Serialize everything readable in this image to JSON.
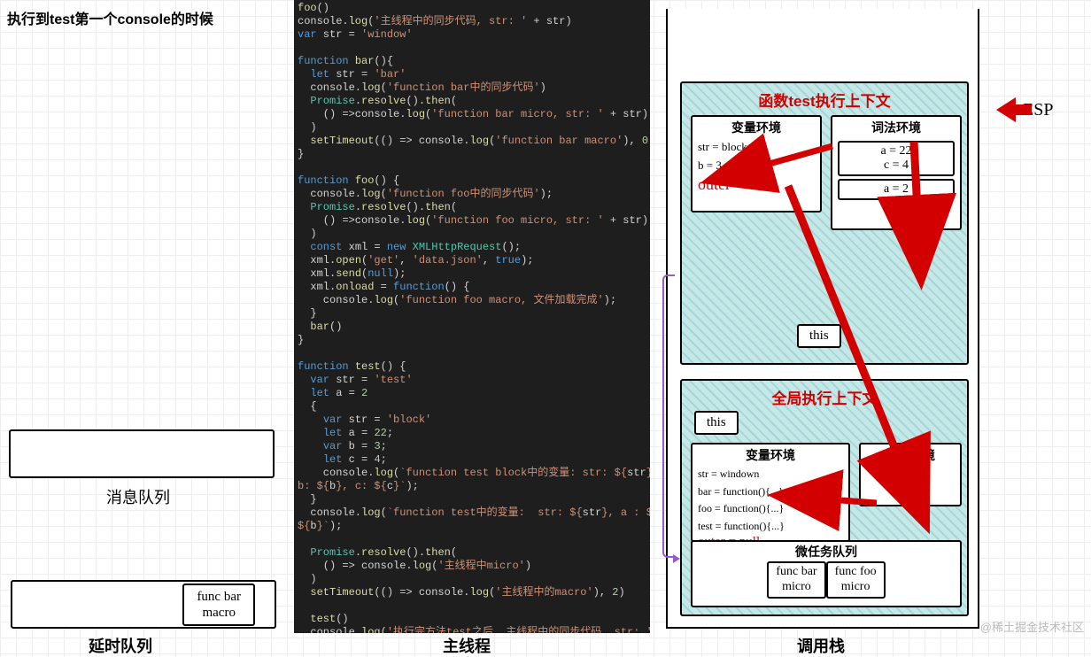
{
  "title": "执行到test第一个console的时候",
  "labels": {
    "message_queue": "消息队列",
    "delay_queue": "延时队列",
    "main_thread": "主线程",
    "call_stack": "调用栈",
    "esp": "ESP"
  },
  "delay_queue_items": [
    {
      "line1": "func bar",
      "line2": "macro"
    }
  ],
  "code": {
    "lines": [
      [
        [
          "fn",
          "foo"
        ],
        [
          "",
          "()"
        ]
      ],
      [
        [
          "",
          "console."
        ],
        [
          "fn",
          "log"
        ],
        [
          "",
          "("
        ],
        [
          "str",
          "'主线程中的同步代码, str: '"
        ],
        [
          "",
          "",
          " + str)"
        ]
      ],
      [
        [
          "kw",
          "var"
        ],
        [
          "",
          " str = "
        ],
        [
          "str",
          "'window'"
        ]
      ],
      [
        [
          "",
          ""
        ]
      ],
      [
        [
          "kw",
          "function"
        ],
        [
          "",
          " "
        ],
        [
          "fn",
          "bar"
        ],
        [
          "",
          "(){"
        ]
      ],
      [
        [
          "",
          "  "
        ],
        [
          "kw",
          "let"
        ],
        [
          "",
          " str = "
        ],
        [
          "str",
          "'bar'"
        ]
      ],
      [
        [
          "",
          "  console."
        ],
        [
          "fn",
          "log"
        ],
        [
          "",
          "("
        ],
        [
          "str",
          "'function bar中的同步代码'"
        ],
        [
          "",
          ")"
        ]
      ],
      [
        [
          "",
          "  "
        ],
        [
          "cls",
          "Promise"
        ],
        [
          "",
          "."
        ],
        [
          "fn",
          "resolve"
        ],
        [
          "",
          "()."
        ],
        [
          "fn",
          "then"
        ],
        [
          "",
          "("
        ]
      ],
      [
        [
          "",
          "    () =>console."
        ],
        [
          "fn",
          "log"
        ],
        [
          "",
          "("
        ],
        [
          "str",
          "'function bar micro, str: '"
        ],
        [
          "",
          "",
          " + str)"
        ]
      ],
      [
        [
          "",
          "  )"
        ]
      ],
      [
        [
          "",
          "  "
        ],
        [
          "fn",
          "setTimeout"
        ],
        [
          "",
          "(() => console."
        ],
        [
          "fn",
          "log"
        ],
        [
          "",
          "("
        ],
        [
          "str",
          "'function bar macro'"
        ],
        [
          "",
          "), "
        ],
        [
          "num",
          "0"
        ],
        [
          "",
          ")"
        ]
      ],
      [
        [
          "",
          "}"
        ]
      ],
      [
        [
          "",
          ""
        ]
      ],
      [
        [
          "kw",
          "function"
        ],
        [
          "",
          " "
        ],
        [
          "fn",
          "foo"
        ],
        [
          "",
          "() {"
        ]
      ],
      [
        [
          "",
          "  console."
        ],
        [
          "fn",
          "log"
        ],
        [
          "",
          "("
        ],
        [
          "str",
          "'function foo中的同步代码'"
        ],
        [
          "",
          ");"
        ]
      ],
      [
        [
          "",
          "  "
        ],
        [
          "cls",
          "Promise"
        ],
        [
          "",
          "."
        ],
        [
          "fn",
          "resolve"
        ],
        [
          "",
          "()."
        ],
        [
          "fn",
          "then"
        ],
        [
          "",
          "("
        ]
      ],
      [
        [
          "",
          "    () =>console."
        ],
        [
          "fn",
          "log"
        ],
        [
          "",
          "("
        ],
        [
          "str",
          "'function foo micro, str: '"
        ],
        [
          "",
          "",
          " + str)"
        ]
      ],
      [
        [
          "",
          "  )"
        ]
      ],
      [
        [
          "",
          "  "
        ],
        [
          "kw",
          "const"
        ],
        [
          "",
          " xml = "
        ],
        [
          "kw",
          "new"
        ],
        [
          "",
          " "
        ],
        [
          "cls",
          "XMLHttpRequest"
        ],
        [
          "",
          "();"
        ]
      ],
      [
        [
          "",
          "  xml."
        ],
        [
          "fn",
          "open"
        ],
        [
          "",
          "("
        ],
        [
          "str",
          "'get'"
        ],
        [
          "",
          ", "
        ],
        [
          "str",
          "'data.json'"
        ],
        [
          "",
          ", "
        ],
        [
          "kw",
          "true"
        ],
        [
          "",
          ");"
        ]
      ],
      [
        [
          "",
          "  xml."
        ],
        [
          "fn",
          "send"
        ],
        [
          "",
          "("
        ],
        [
          "kw",
          "null"
        ],
        [
          "",
          ");"
        ]
      ],
      [
        [
          "",
          "  xml."
        ],
        [
          "fn",
          "onload"
        ],
        [
          "",
          " = "
        ],
        [
          "kw",
          "function"
        ],
        [
          "",
          "() {"
        ]
      ],
      [
        [
          "",
          "    console."
        ],
        [
          "fn",
          "log"
        ],
        [
          "",
          "("
        ],
        [
          "str",
          "'function foo macro, 文件加载完成'"
        ],
        [
          "",
          ");"
        ]
      ],
      [
        [
          "",
          "  }"
        ]
      ],
      [
        [
          "",
          "  "
        ],
        [
          "fn",
          "bar"
        ],
        [
          "",
          "()"
        ]
      ],
      [
        [
          "",
          "}"
        ]
      ],
      [
        [
          "",
          ""
        ]
      ],
      [
        [
          "kw",
          "function"
        ],
        [
          "",
          " "
        ],
        [
          "fn",
          "test"
        ],
        [
          "",
          "() {"
        ]
      ],
      [
        [
          "",
          "  "
        ],
        [
          "kw",
          "var"
        ],
        [
          "",
          " str = "
        ],
        [
          "str",
          "'test'"
        ]
      ],
      [
        [
          "",
          "  "
        ],
        [
          "kw",
          "let"
        ],
        [
          "",
          " a = "
        ],
        [
          "num",
          "2"
        ]
      ],
      [
        [
          "",
          "  {"
        ]
      ],
      [
        [
          "",
          "    "
        ],
        [
          "kw",
          "var"
        ],
        [
          "",
          " str = "
        ],
        [
          "str",
          "'block'"
        ]
      ],
      [
        [
          "",
          "    "
        ],
        [
          "kw",
          "let"
        ],
        [
          "",
          " a = "
        ],
        [
          "num",
          "22"
        ],
        [
          "",
          ";"
        ]
      ],
      [
        [
          "",
          "    "
        ],
        [
          "kw",
          "var"
        ],
        [
          "",
          " b = "
        ],
        [
          "num",
          "3"
        ],
        [
          "",
          ";"
        ]
      ],
      [
        [
          "",
          "    "
        ],
        [
          "kw",
          "let"
        ],
        [
          "",
          " c = "
        ],
        [
          "num",
          "4"
        ],
        [
          "",
          ";"
        ]
      ],
      [
        [
          "",
          "    console."
        ],
        [
          "fn",
          "log"
        ],
        [
          "",
          "("
        ],
        [
          "str",
          "`function test block中的变量: str: ${"
        ],
        [
          "",
          "str"
        ],
        [
          "str",
          "}, a : ${"
        ],
        [
          "",
          "a"
        ],
        [
          "str",
          "},"
        ]
      ],
      [
        [
          "str",
          "b: ${"
        ],
        [
          "",
          "b"
        ],
        [
          "str",
          "}, c: ${"
        ],
        [
          "",
          "c"
        ],
        [
          "str",
          "}`"
        ],
        [
          "",
          ");"
        ]
      ],
      [
        [
          "",
          "  }"
        ]
      ],
      [
        [
          "",
          "  console."
        ],
        [
          "fn",
          "log"
        ],
        [
          "",
          "("
        ],
        [
          "str",
          "`function test中的变量:  str: ${"
        ],
        [
          "",
          "str"
        ],
        [
          "str",
          "}, a : ${"
        ],
        [
          "",
          "a"
        ],
        [
          "str",
          "}, b:"
        ]
      ],
      [
        [
          "str",
          "${"
        ],
        [
          "",
          "b"
        ],
        [
          "str",
          "}`"
        ],
        [
          "",
          ");"
        ]
      ],
      [
        [
          "",
          ""
        ]
      ],
      [
        [
          "",
          "  "
        ],
        [
          "cls",
          "Promise"
        ],
        [
          "",
          "."
        ],
        [
          "fn",
          "resolve"
        ],
        [
          "",
          "()."
        ],
        [
          "fn",
          "then"
        ],
        [
          "",
          "("
        ]
      ],
      [
        [
          "",
          "    () => console."
        ],
        [
          "fn",
          "log"
        ],
        [
          "",
          "("
        ],
        [
          "str",
          "'主线程中micro'"
        ],
        [
          "",
          ")"
        ]
      ],
      [
        [
          "",
          "  )"
        ]
      ],
      [
        [
          "",
          "  "
        ],
        [
          "fn",
          "setTimeout"
        ],
        [
          "",
          "(() => console."
        ],
        [
          "fn",
          "log"
        ],
        [
          "",
          "("
        ],
        [
          "str",
          "'主线程中的macro'"
        ],
        [
          "",
          "), "
        ],
        [
          "num",
          "2"
        ],
        [
          "",
          ")"
        ]
      ],
      [
        [
          "",
          ""
        ]
      ],
      [
        [
          "",
          "  "
        ],
        [
          "fn",
          "test"
        ],
        [
          "",
          "()"
        ]
      ],
      [
        [
          "",
          "  console."
        ],
        [
          "fn",
          "log"
        ],
        [
          "",
          "("
        ],
        [
          "str",
          "'执行完方法test之后, 主线程中的同步代码, str: '"
        ],
        [
          "",
          "",
          " + str);"
        ]
      ]
    ]
  },
  "call_stack": {
    "test_ctx": {
      "title": "函数test执行上下文",
      "var_env": {
        "title": "变量环境",
        "lines": [
          "str = block",
          "b = 3"
        ],
        "outer": "outer"
      },
      "lex_env": {
        "title": "词法环境",
        "blocks": [
          [
            "a = 22",
            "c = 4"
          ],
          [
            "a = 2"
          ]
        ]
      },
      "this": "this"
    },
    "global_ctx": {
      "title": "全局执行上下文",
      "this": "this",
      "var_env": {
        "title": "变量环境",
        "lines": [
          "str = windown",
          "bar = function(){...}",
          "foo = function(){...}",
          "test = function(){...}"
        ],
        "outer": "outer = null"
      },
      "lex_env": {
        "title": "词法环境"
      },
      "microtask": {
        "title": "微任务队列",
        "items": [
          {
            "line1": "func bar",
            "line2": "micro"
          },
          {
            "line1": "func foo",
            "line2": "micro"
          }
        ]
      }
    }
  },
  "watermark": "@稀土掘金技术社区"
}
